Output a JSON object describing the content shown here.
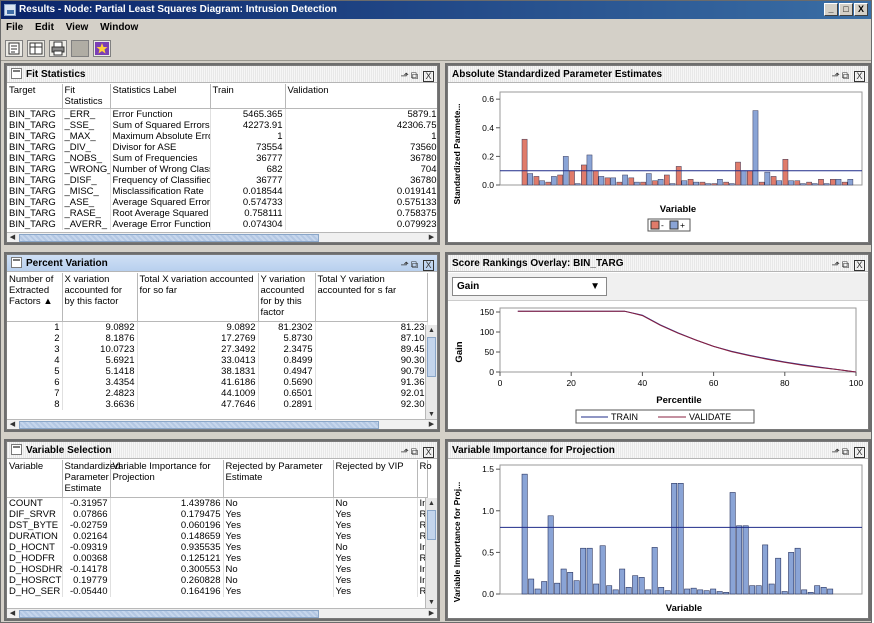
{
  "window": {
    "title": "Results - Node: Partial Least Squares Diagram: Intrusion Detection",
    "buttons": {
      "minimize": "_",
      "maximize": "□",
      "close": "X"
    }
  },
  "menu": [
    "File",
    "Edit",
    "View",
    "Window"
  ],
  "toolbar": {
    "icons": [
      "properties-icon",
      "table-view-icon",
      "print-icon",
      "disabled-icon",
      "wand-icon"
    ]
  },
  "panel_buttons": {
    "restore": "⌐",
    "maximize": "⊡",
    "close": "X"
  },
  "fit_statistics": {
    "title": "Fit Statistics",
    "columns": [
      "Target",
      "Fit Statistics",
      "Statistics Label",
      "Train",
      "Validation"
    ],
    "rows": [
      [
        "BIN_TARG",
        "_ERR_",
        "Error Function",
        "5465.365",
        "5879.1"
      ],
      [
        "BIN_TARG",
        "_SSE_",
        "Sum of Squared Errors",
        "42273.91",
        "42306.75"
      ],
      [
        "BIN_TARG",
        "_MAX_",
        "Maximum Absolute Error",
        "1",
        "1"
      ],
      [
        "BIN_TARG",
        "_DIV_",
        "Divisor for ASE",
        "73554",
        "73560"
      ],
      [
        "BIN_TARG",
        "_NOBS_",
        "Sum of Frequencies",
        "36777",
        "36780"
      ],
      [
        "BIN_TARG",
        "_WRONG_",
        "Number of Wrong Classific...",
        "682",
        "704"
      ],
      [
        "BIN_TARG",
        "_DISF_",
        "Frequency of Classified Ca...",
        "36777",
        "36780"
      ],
      [
        "BIN_TARG",
        "_MISC_",
        "Misclassification Rate",
        "0.018544",
        "0.019141"
      ],
      [
        "BIN_TARG",
        "_ASE_",
        "Average Squared Error",
        "0.574733",
        "0.575133"
      ],
      [
        "BIN_TARG",
        "_RASE_",
        "Root Average Squared Error",
        "0.758111",
        "0.758375"
      ],
      [
        "BIN_TARG",
        "_AVERR_",
        "Average Error Function",
        "0.074304",
        "0.079923"
      ]
    ]
  },
  "percent_variation": {
    "title": "Percent Variation",
    "columns": [
      "Number of Extracted Factors ▲",
      "X variation accounted for by this factor",
      "Total X variation accounted for so far",
      "Y variation accounted for by this factor",
      "Total Y variation accounted for s far"
    ],
    "rows": [
      [
        "1",
        "9.0892",
        "9.0892",
        "81.2302",
        "81.23"
      ],
      [
        "2",
        "8.1876",
        "17.2769",
        "5.8730",
        "87.10"
      ],
      [
        "3",
        "10.0723",
        "27.3492",
        "2.3475",
        "89.45"
      ],
      [
        "4",
        "5.6921",
        "33.0413",
        "0.8499",
        "90.30"
      ],
      [
        "5",
        "5.1418",
        "38.1831",
        "0.4947",
        "90.79"
      ],
      [
        "6",
        "3.4354",
        "41.6186",
        "0.5690",
        "91.36"
      ],
      [
        "7",
        "2.4823",
        "44.1009",
        "0.6501",
        "92.01"
      ],
      [
        "8",
        "3.6636",
        "47.7646",
        "0.2891",
        "92.30"
      ]
    ]
  },
  "variable_selection": {
    "title": "Variable Selection",
    "columns": [
      "Variable",
      "Standardized Parameter Estimate",
      "Variable Importance for Projection",
      "Rejected by Parameter Estimate",
      "Rejected by VIP",
      "Ro"
    ],
    "rows": [
      [
        "COUNT",
        "-0.31957",
        "1.439786",
        "No",
        "No",
        "Inp"
      ],
      [
        "DIF_SRVR",
        "0.07866",
        "0.179475",
        "Yes",
        "Yes",
        "Re"
      ],
      [
        "DST_BYTE",
        "-0.02759",
        "0.060196",
        "Yes",
        "Yes",
        "Re"
      ],
      [
        "DURATION",
        "0.02164",
        "0.148659",
        "Yes",
        "Yes",
        "Re"
      ],
      [
        "D_HOCNT",
        "-0.09319",
        "0.935535",
        "Yes",
        "No",
        "Inp"
      ],
      [
        "D_HODFR",
        "0.00368",
        "0.125121",
        "Yes",
        "Yes",
        "Re"
      ],
      [
        "D_HOSDHR",
        "-0.14178",
        "0.300553",
        "No",
        "Yes",
        "Inp"
      ],
      [
        "D_HOSRCT",
        "0.19779",
        "0.260828",
        "No",
        "Yes",
        "Inp"
      ],
      [
        "D_HO_SER",
        "-0.05440",
        "0.164196",
        "Yes",
        "Yes",
        "Re"
      ]
    ]
  },
  "param_estimates_chart": {
    "title": "Absolute Standardized Parameter Estimates",
    "ylabel": "Standardized Paramete...",
    "xlabel": "Variable",
    "yticks": [
      "0.0",
      "0.2",
      "0.4",
      "0.6"
    ],
    "ylim": [
      0,
      0.65
    ],
    "threshold": 0.1,
    "legend": [
      "-",
      "+"
    ],
    "colors": {
      "negative": "#e07b6a",
      "positive": "#8aa4d6",
      "threshold": "#1f2c8a"
    }
  },
  "score_rankings_chart": {
    "title": "Score Rankings Overlay: BIN_TARG",
    "dropdown": "Gain",
    "ylabel": "Gain",
    "xlabel": "Percentile",
    "yticks": [
      "0",
      "50",
      "100",
      "150"
    ],
    "xticks": [
      "0",
      "20",
      "40",
      "60",
      "80",
      "100"
    ],
    "legend": [
      "TRAIN",
      "VALIDATE"
    ],
    "colors": {
      "train": "#1f2c8a",
      "validate": "#8a2040"
    }
  },
  "vip_chart": {
    "title": "Variable Importance for Projection",
    "ylabel": "Variable Importance for Proj...",
    "xlabel": "Variable",
    "yticks": [
      "0.0",
      "0.5",
      "1.0",
      "1.5"
    ],
    "ylim": [
      0,
      1.55
    ],
    "threshold": 0.8,
    "colors": {
      "bar": "#8aa4d6",
      "threshold": "#1f2c8a"
    }
  },
  "chart_data": [
    {
      "type": "bar",
      "title": "Absolute Standardized Parameter Estimates",
      "xlabel": "Variable",
      "ylabel": "Standardized Paramete...",
      "ylim": [
        0,
        0.65
      ],
      "reference_line": 0.1,
      "series": [
        {
          "name": "-",
          "values": [
            0.32,
            0.06,
            0.02,
            0.07,
            0.1,
            0.14,
            0.1,
            0.05,
            0.02,
            0.05,
            0.02,
            0.03,
            0.07,
            0.13,
            0.04,
            0.02,
            0.01,
            0.02,
            0.16,
            0.1,
            0.02,
            0.06,
            0.18,
            0.03,
            0.02,
            0.04,
            0.04,
            0.02
          ]
        },
        {
          "name": "+",
          "values": [
            0.08,
            0.03,
            0.06,
            0.2,
            0.01,
            0.21,
            0.06,
            0.05,
            0.07,
            0.02,
            0.08,
            0.04,
            0.01,
            0.03,
            0.02,
            0.01,
            0.04,
            0.01,
            0.1,
            0.52,
            0.09,
            0.03,
            0.03,
            0.01,
            0.01,
            0.01,
            0.04,
            0.04
          ]
        }
      ]
    },
    {
      "type": "line",
      "title": "Score Rankings Overlay: BIN_TARG",
      "xlabel": "Percentile",
      "ylabel": "Gain",
      "x": [
        5,
        10,
        15,
        20,
        25,
        30,
        35,
        40,
        45,
        50,
        55,
        60,
        65,
        70,
        75,
        80,
        85,
        90,
        95,
        100
      ],
      "series": [
        {
          "name": "TRAIN",
          "values": [
            152,
            152,
            152,
            152,
            152,
            152,
            152,
            142,
            118,
            98,
            80,
            64,
            52,
            42,
            33,
            25,
            18,
            12,
            6,
            0
          ]
        },
        {
          "name": "VALIDATE",
          "values": [
            152,
            152,
            152,
            152,
            152,
            152,
            152,
            141,
            117,
            97,
            80,
            64,
            51,
            41,
            32,
            24,
            17,
            11,
            6,
            0
          ]
        }
      ]
    },
    {
      "type": "bar",
      "title": "Variable Importance for Projection",
      "xlabel": "Variable",
      "ylabel": "Variable Importance for Proj...",
      "ylim": [
        0,
        1.55
      ],
      "reference_line": 0.8,
      "values": [
        1.44,
        0.18,
        0.06,
        0.15,
        0.94,
        0.13,
        0.3,
        0.26,
        0.16,
        0.55,
        0.55,
        0.12,
        0.58,
        0.1,
        0.05,
        0.3,
        0.08,
        0.22,
        0.2,
        0.05,
        0.56,
        0.08,
        0.04,
        1.33,
        1.33,
        0.06,
        0.07,
        0.05,
        0.04,
        0.06,
        0.03,
        0.02,
        1.22,
        0.82,
        0.82,
        0.1,
        0.1,
        0.59,
        0.12,
        0.43,
        0.03,
        0.5,
        0.55,
        0.05,
        0.02,
        0.1,
        0.08,
        0.06
      ]
    }
  ]
}
